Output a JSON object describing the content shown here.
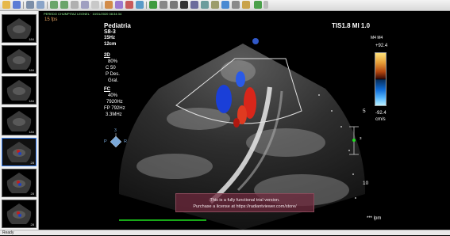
{
  "toolbar": {
    "icons": [
      "folder-icon",
      "save-icon",
      "grid-icon",
      "arrow-icon",
      "undo-icon",
      "redo-icon",
      "zoom-icon",
      "pan-icon",
      "window-level-icon",
      "measure-icon",
      "angle-icon",
      "ellipse-icon",
      "text-icon",
      "play-icon",
      "cine-icon",
      "info-icon",
      "settings-icon",
      "help-icon"
    ]
  },
  "sidebar": {
    "thumbnails": [
      {
        "count": "184"
      },
      {
        "count": "184"
      },
      {
        "count": "184"
      },
      {
        "count": "184"
      },
      {
        "count": "28"
      },
      {
        "count": "28"
      },
      {
        "count": "28"
      }
    ]
  },
  "viewer": {
    "patient_header": "PEREDO CHUMPITAZ LEONEL · 10/31/2020 08:34:34",
    "fps": "15 fps",
    "preset_name": "Pediatria",
    "probe": "S8-3",
    "frequency": "15Hz",
    "depth": "12cm",
    "mode_2d": "2D",
    "gain_2d": "80%",
    "c_value": "C 50",
    "p_value": "P Des.",
    "gral": "Gral.",
    "mode_fc": "FC",
    "fc_gain": "40%",
    "fc_freq": "7920Hz",
    "fp": "FP 792Hz",
    "mhz": "3.3MHz",
    "tis_mi": "TIS1.8   MI 1.0",
    "m4_label": "M4  M4",
    "scale_top": "+92.4",
    "scale_bottom": "-92.4",
    "scale_unit": "cm/s",
    "depth_5": "5",
    "depth_10": "10",
    "orientation_num": "3",
    "orientation_p": "P",
    "orientation_r": "R",
    "bpm": "*** lpm",
    "watermark_line1": "This is a fully functional trial version.",
    "watermark_line2": "Purchase a license at https://radiantviewer.com/store/"
  },
  "status_bar": {
    "text": "Ready"
  },
  "colors": {
    "accent_green": "#20e020",
    "doppler_red": "#d8261a",
    "doppler_blue": "#1a3fd8",
    "watermark_bg": "#6e283c"
  }
}
